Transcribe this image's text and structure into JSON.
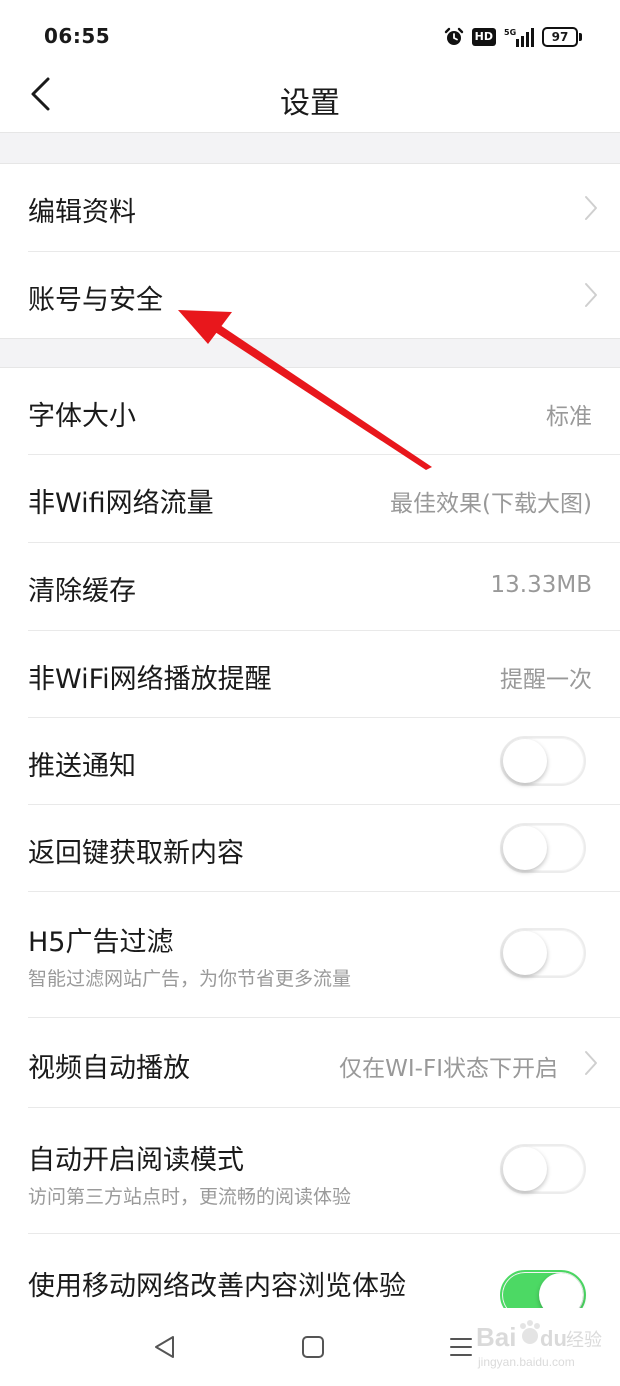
{
  "status_bar": {
    "time": "06:55",
    "hd": "HD",
    "network": "5G",
    "battery": "97"
  },
  "header": {
    "title": "设置",
    "back_icon": "chevron-left-icon"
  },
  "sections": {
    "account": [
      {
        "label": "编辑资料"
      },
      {
        "label": "账号与安全"
      }
    ]
  },
  "settings": {
    "font_size": {
      "label": "字体大小",
      "value": "标准"
    },
    "non_wifi_traffic": {
      "label": "非Wifi网络流量",
      "value": "最佳效果(下载大图)"
    },
    "clear_cache": {
      "label": "清除缓存",
      "value": "13.33MB"
    },
    "non_wifi_play_alert": {
      "label": "非WiFi网络播放提醒",
      "value": "提醒一次"
    },
    "push": {
      "label": "推送通知",
      "on": false
    },
    "back_key_refresh": {
      "label": "返回键获取新内容",
      "on": false
    },
    "h5_ad_filter": {
      "label": "H5广告过滤",
      "sub": "智能过滤网站广告，为你节省更多流量",
      "on": false
    },
    "video_autoplay": {
      "label": "视频自动播放",
      "value": "仅在WI-FI状态下开启"
    },
    "auto_reading_mode": {
      "label": "自动开启阅读模式",
      "sub": "访问第三方站点时，更流畅的阅读体验",
      "on": false
    },
    "mobile_network_improve": {
      "label": "使用移动网络改善内容浏览体验",
      "on": true
    }
  },
  "colors": {
    "toggle_on": "#4cd964",
    "annotation_arrow": "#e8171c",
    "section_gap": "#f3f3f5"
  },
  "watermark": {
    "brand": "Bai",
    "brand2": "du",
    "suffix": "经验",
    "url": "jingyan.baidu.com"
  }
}
